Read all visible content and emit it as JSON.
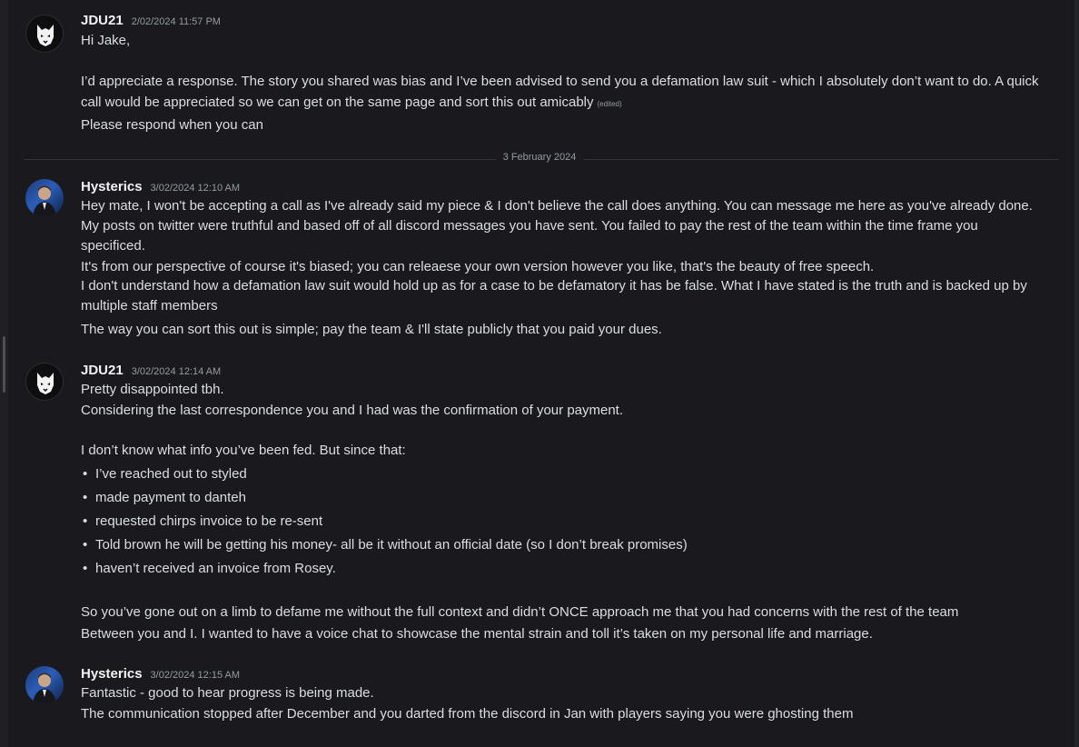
{
  "date_divider": "3 February 2024",
  "messages": [
    {
      "author": "JDU21",
      "timestamp": "2/02/2024 11:57 PM",
      "avatar": "wolf-logo-avatar",
      "lines": [
        "Hi Jake,",
        "",
        "I’d appreciate a response. The story you shared was bias and I’ve been advised to send you a defamation law suit - which I absolutely don’t want to do. A quick",
        "call would be appreciated so we can get on the same page and sort this out amicably",
        "Please respond when you can"
      ],
      "edited_label": "(edited)"
    },
    {
      "author": "Hysterics",
      "timestamp": "3/02/2024 12:10 AM",
      "avatar": "user-photo-avatar",
      "lines": [
        "Hey mate, I won't be accepting a call as I've already said my piece & I don't believe the call does anything. You can message me here as you've already done.",
        " My posts on twitter were truthful and based off of all discord messages you have sent. You failed to pay the rest of the team within the time frame you",
        "specificed.",
        "It's from our perspective of course it's biased; you can releaese your own version however you like, that's the beauty of free speech.",
        "I don't understand how a defamation law suit would hold up as for a case to be defamatory it has be false. What I have stated is the truth and is backed up by",
        "multiple staff members",
        "The way you can sort this out is simple; pay the team & I'll state publicly that you paid your dues."
      ]
    },
    {
      "author": "JDU21",
      "timestamp": "3/02/2024 12:14 AM",
      "avatar": "wolf-logo-avatar",
      "lines_before": [
        "Pretty disappointed tbh.",
        "Considering the last correspondence you and I had was the confirmation of your payment.",
        "",
        "I don’t know what info you’ve been fed. But since that:"
      ],
      "bullets": [
        "I’ve reached out to styled",
        "made payment to danteh",
        "requested chirps invoice to be re-sent",
        "Told brown he will be getting his money- all be it without an official date (so I don’t break promises)",
        "haven’t received an invoice from Rosey."
      ],
      "lines_after": [
        "",
        "So you’ve gone out on a limb to defame me without the full context and didn’t ONCE approach me that you had concerns with the rest of the team",
        "Between you and I. I wanted to have a voice chat to showcase the mental strain and toll it’s taken on my personal life and marriage."
      ]
    },
    {
      "author": "Hysterics",
      "timestamp": "3/02/2024 12:15 AM",
      "avatar": "user-photo-avatar",
      "lines": [
        "Fantastic - good to hear progress is being made.",
        "The communication stopped after December and you darted from the discord in Jan with players saying you were ghosting them"
      ]
    }
  ]
}
